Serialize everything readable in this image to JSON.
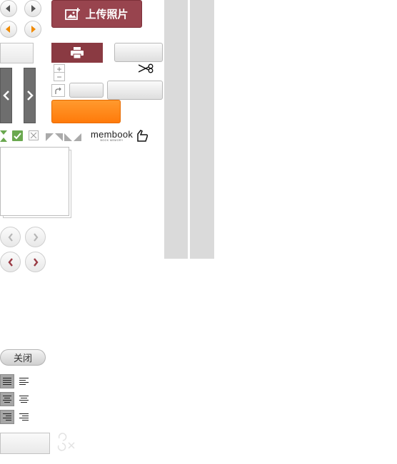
{
  "upload": {
    "label": "上传照片"
  },
  "close": {
    "label": "关闭"
  },
  "brand": {
    "name": "membook",
    "tagline": "BOOK MEMORY"
  },
  "zoom": {
    "plus": "+",
    "minus": "−"
  },
  "icons": {
    "prev": "chevron-left-icon",
    "next": "chevron-right-icon",
    "print": "printer-icon",
    "scissors": "scissors-icon",
    "redo": "redo-icon",
    "check": "check-icon",
    "uncheck": "x-icon"
  },
  "colors": {
    "accent_red": "#98444e",
    "accent_orange": "#ff8a1a",
    "check_green": "#6aa84f",
    "arrow_orange": "#f08a00"
  }
}
